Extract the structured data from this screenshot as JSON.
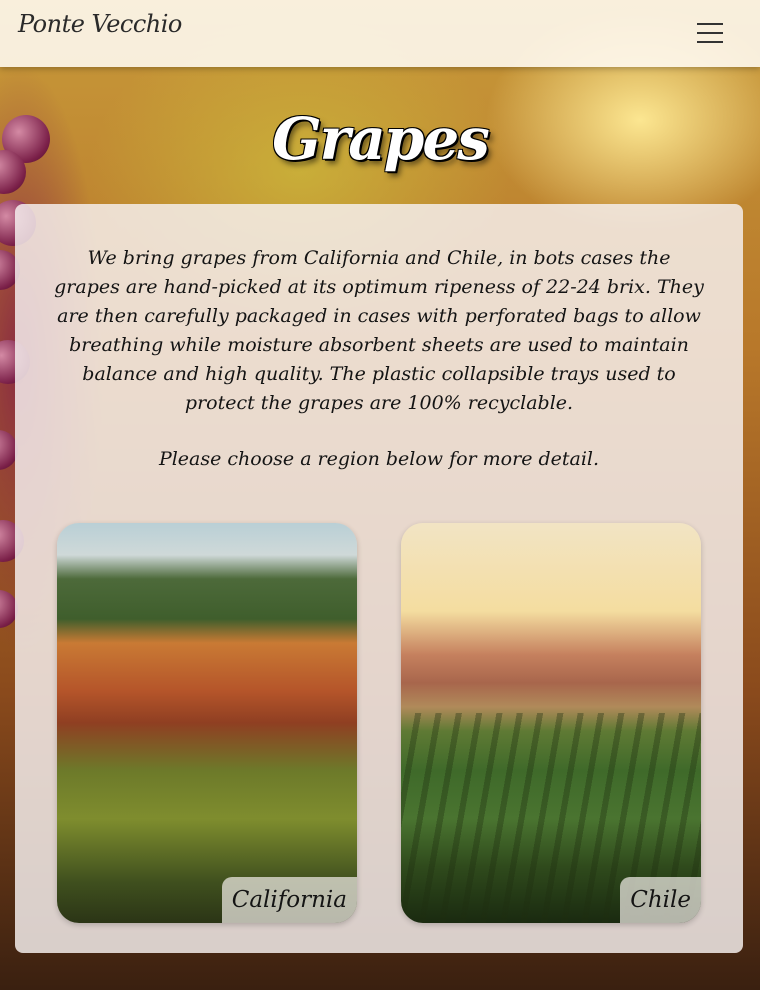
{
  "header": {
    "logo": "Ponte Vecchio"
  },
  "page": {
    "title": "Grapes",
    "intro": "We bring grapes from California and Chile, in bots cases the grapes are hand-picked at its optimum ripeness of 22-24 brix. They are then carefully packaged in cases with perforated bags to allow breathing while moisture absorbent sheets are used to maintain balance and high quality. The plastic collapsible trays used to protect the grapes are 100% recyclable.",
    "prompt": "Please choose a region below for more detail."
  },
  "regions": [
    {
      "label": "California"
    },
    {
      "label": "Chile"
    }
  ],
  "icons": {
    "menu": "hamburger-menu-icon"
  }
}
